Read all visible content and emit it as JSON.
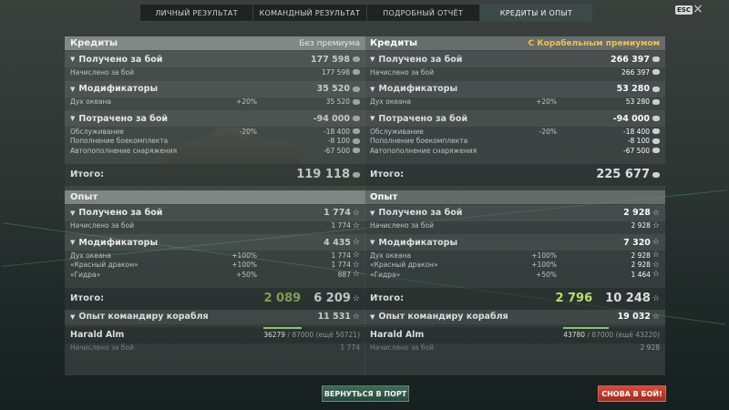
{
  "tabs": [
    {
      "label": "ЛИЧНЫЙ РЕЗУЛЬТАТ"
    },
    {
      "label": "КОМАНДНЫЙ РЕЗУЛЬТАТ"
    },
    {
      "label": "ПОДРОБНЫЙ ОТЧЁТ"
    },
    {
      "label": "КРЕДИТЫ И ОПЫТ"
    }
  ],
  "esc_label": "ESC",
  "close_symbol": "×",
  "left": {
    "credits_title": "Кредиты",
    "premium_label": "Без премиума",
    "received": {
      "label": "Получено за бой",
      "value": "177 598",
      "rows": [
        {
          "label": "Начислено за бой",
          "pct": "",
          "value": "177 598"
        }
      ]
    },
    "modifiers": {
      "label": "Модификаторы",
      "value": "35 520",
      "rows": [
        {
          "label": "Дух океана",
          "pct": "+20%",
          "value": "35 520"
        }
      ]
    },
    "spent": {
      "label": "Потрачено за бой",
      "value": "-94 000",
      "rows": [
        {
          "label": "Обслуживание",
          "pct": "-20%",
          "value": "-18 400"
        },
        {
          "label": "Пополнение боекомплекта",
          "pct": "",
          "value": "-8 100"
        },
        {
          "label": "Автопополнение снаряжения",
          "pct": "",
          "value": "-67 500"
        }
      ]
    },
    "credits_total_label": "Итого:",
    "credits_total": "119 118",
    "exp_title": "Опыт",
    "exp_received": {
      "label": "Получено за бой",
      "value": "1 774",
      "rows": [
        {
          "label": "Начислено за бой",
          "pct": "",
          "value": "1 774"
        }
      ]
    },
    "exp_modifiers": {
      "label": "Модификаторы",
      "value": "4 435",
      "rows": [
        {
          "label": "Дух океана",
          "pct": "+100%",
          "value": "1 774"
        },
        {
          "label": "«Красный дракон»",
          "pct": "+100%",
          "value": "1 774"
        },
        {
          "label": "«Гидра»",
          "pct": "+50%",
          "value": "887"
        }
      ]
    },
    "exp_total_label": "Итого:",
    "exp_total_free": "2 089",
    "exp_total": "6 209",
    "commander": {
      "label": "Опыт командиру корабля",
      "value": "11 531"
    },
    "captain": {
      "name": "Harald Alm",
      "current": "36279",
      "max": "/ 87000",
      "remain": "(ещё 50721)",
      "progress": 0.417
    },
    "last_row": {
      "label": "Начислено за бой",
      "value": "1 774"
    }
  },
  "right": {
    "credits_title": "Кредиты",
    "premium_label": "С Корабельным премиумом",
    "received": {
      "label": "Получено за бой",
      "value": "266 397",
      "rows": [
        {
          "label": "Начислено за бой",
          "pct": "",
          "value": "266 397"
        }
      ]
    },
    "modifiers": {
      "label": "Модификаторы",
      "value": "53 280",
      "rows": [
        {
          "label": "Дух океана",
          "pct": "+20%",
          "value": "53 280"
        }
      ]
    },
    "spent": {
      "label": "Потрачено за бой",
      "value": "-94 000",
      "rows": [
        {
          "label": "Обслуживание",
          "pct": "-20%",
          "value": "-18 400"
        },
        {
          "label": "Пополнение боекомплекта",
          "pct": "",
          "value": "-8 100"
        },
        {
          "label": "Автопополнение снаряжения",
          "pct": "",
          "value": "-67 500"
        }
      ]
    },
    "credits_total_label": "Итого:",
    "credits_total": "225 677",
    "exp_title": "Опыт",
    "exp_received": {
      "label": "Получено за бой",
      "value": "2 928",
      "rows": [
        {
          "label": "Начислено за бой",
          "pct": "",
          "value": "2 928"
        }
      ]
    },
    "exp_modifiers": {
      "label": "Модификаторы",
      "value": "7 320",
      "rows": [
        {
          "label": "Дух океана",
          "pct": "+100%",
          "value": "2 928"
        },
        {
          "label": "«Красный дракон»",
          "pct": "+100%",
          "value": "2 928"
        },
        {
          "label": "«Гидра»",
          "pct": "+50%",
          "value": "1 464"
        }
      ]
    },
    "exp_total_label": "Итого:",
    "exp_total_free": "2 796",
    "exp_total": "10 248",
    "commander": {
      "label": "Опыт командиру корабля",
      "value": "19 032"
    },
    "captain": {
      "name": "Harald Alm",
      "current": "43780",
      "max": "/ 87000",
      "remain": "(ещё 43220)",
      "progress": 0.503
    },
    "last_row": {
      "label": "Начислено за бой",
      "value": "2 928"
    }
  },
  "buttons": {
    "port": "ВЕРНУТЬСЯ В ПОРТ",
    "battle": "СНОВА В БОЙ!"
  },
  "icons": {
    "credit": "credit-icon",
    "star": "star-icon"
  },
  "colors": {
    "premium": "#f3c04a",
    "accent_green": "#b8e06a",
    "battle": "#d84a3a"
  }
}
